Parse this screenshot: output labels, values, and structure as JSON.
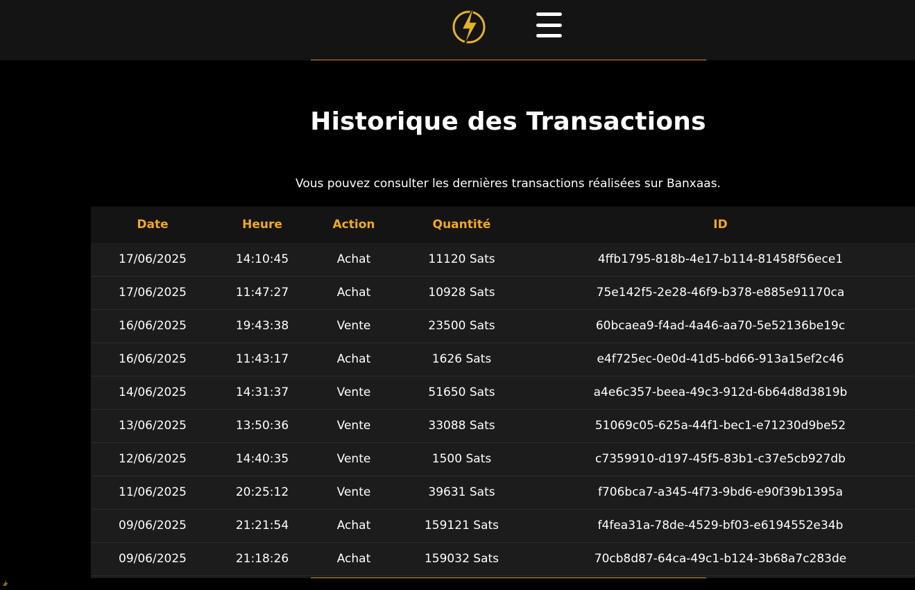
{
  "header": {
    "logo_icon": "lightning-coin-icon",
    "menu_icon": "hamburger-menu-icon",
    "accent_color": "#f0a825"
  },
  "main": {
    "title": "Historique des Transactions",
    "subtitle": "Vous pouvez consulter les dernières transactions réalisées sur Banxaas."
  },
  "table": {
    "columns": [
      "Date",
      "Heure",
      "Action",
      "Quantité",
      "ID"
    ],
    "rows": [
      {
        "date": "17/06/2025",
        "heure": "14:10:45",
        "action": "Achat",
        "quantite": "11120 Sats",
        "id": "4ffb1795-818b-4e17-b114-81458f56ece1"
      },
      {
        "date": "17/06/2025",
        "heure": "11:47:27",
        "action": "Achat",
        "quantite": "10928 Sats",
        "id": "75e142f5-2e28-46f9-b378-e885e91170ca"
      },
      {
        "date": "16/06/2025",
        "heure": "19:43:38",
        "action": "Vente",
        "quantite": "23500 Sats",
        "id": "60bcaea9-f4ad-4a46-aa70-5e52136be19c"
      },
      {
        "date": "16/06/2025",
        "heure": "11:43:17",
        "action": "Achat",
        "quantite": "1626 Sats",
        "id": "e4f725ec-0e0d-41d5-bd66-913a15ef2c46"
      },
      {
        "date": "14/06/2025",
        "heure": "14:31:37",
        "action": "Vente",
        "quantite": "51650 Sats",
        "id": "a4e6c357-beea-49c3-912d-6b64d8d3819b"
      },
      {
        "date": "13/06/2025",
        "heure": "13:50:36",
        "action": "Vente",
        "quantite": "33088 Sats",
        "id": "51069c05-625a-44f1-bec1-e71230d9be52"
      },
      {
        "date": "12/06/2025",
        "heure": "14:40:35",
        "action": "Vente",
        "quantite": "1500 Sats",
        "id": "c7359910-d197-45f5-83b1-c37e5cb927db"
      },
      {
        "date": "11/06/2025",
        "heure": "20:25:12",
        "action": "Vente",
        "quantite": "39631 Sats",
        "id": "f706bca7-a345-4f73-9bd6-e90f39b1395a"
      },
      {
        "date": "09/06/2025",
        "heure": "21:21:54",
        "action": "Achat",
        "quantite": "159121 Sats",
        "id": "f4fea31a-78de-4529-bf03-e6194552e34b"
      },
      {
        "date": "09/06/2025",
        "heure": "21:18:26",
        "action": "Achat",
        "quantite": "159032 Sats",
        "id": "70cb8d87-64ca-49c1-b124-3b68a7c283de"
      }
    ]
  }
}
